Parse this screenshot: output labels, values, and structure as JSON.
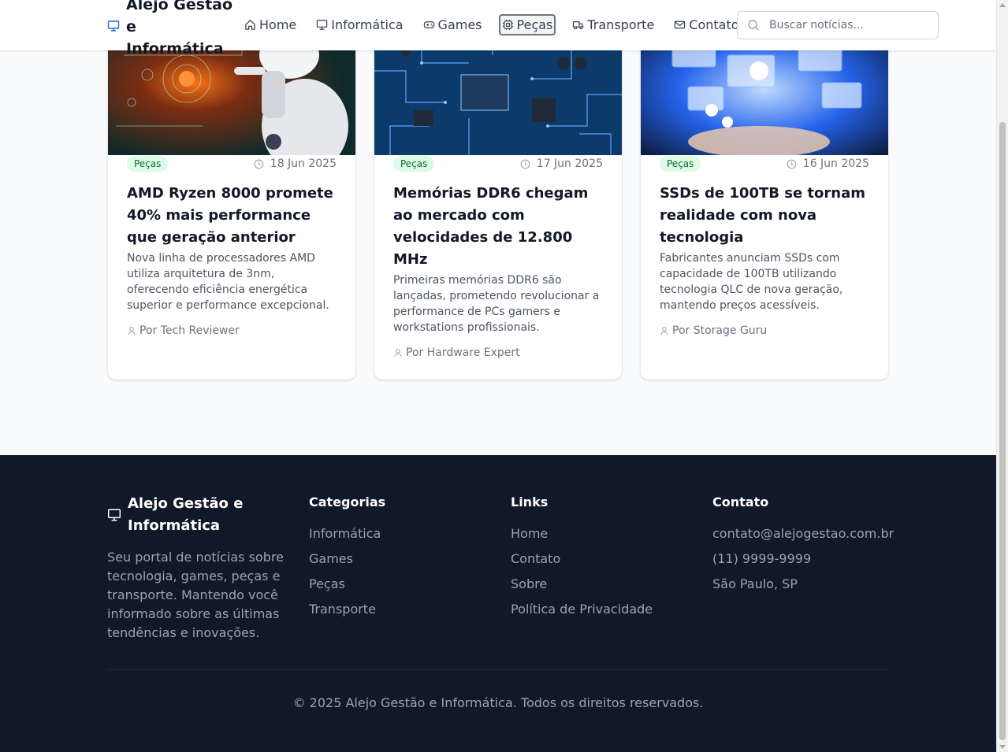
{
  "header": {
    "brand": "Alejo Gestão e Informática",
    "nav": [
      {
        "label": "Home",
        "icon": "home-icon"
      },
      {
        "label": "Informática",
        "icon": "monitor-icon"
      },
      {
        "label": "Games",
        "icon": "gamepad-icon"
      },
      {
        "label": "Peças",
        "icon": "cpu-icon",
        "active": true
      },
      {
        "label": "Transporte",
        "icon": "truck-icon"
      },
      {
        "label": "Contato",
        "icon": "mail-icon"
      }
    ],
    "search": {
      "placeholder": "Buscar notícias...",
      "value": ""
    }
  },
  "cards": [
    {
      "category": "Peças",
      "date": "18 Jun 2025",
      "title": "AMD Ryzen 8000 promete 40% mais performance que geração anterior",
      "description": "Nova linha de processadores AMD utiliza arquitetura de 3nm, oferecendo eficiência energética superior e performance excepcional.",
      "author": "Por Tech Reviewer"
    },
    {
      "category": "Peças",
      "date": "17 Jun 2025",
      "title": "Memórias DDR6 chegam ao mercado com velocidades de 12.800 MHz",
      "description": "Primeiras memórias DDR6 são lançadas, prometendo revolucionar a performance de PCs gamers e workstations profissionais.",
      "author": "Por Hardware Expert"
    },
    {
      "category": "Peças",
      "date": "16 Jun 2025",
      "title": "SSDs de 100TB se tornam realidade com nova tecnologia",
      "description": "Fabricantes anunciam SSDs com capacidade de 100TB utilizando tecnologia QLC de nova geração, mantendo preços acessíveis.",
      "author": "Por Storage Guru"
    }
  ],
  "footer": {
    "brand": "Alejo Gestão e Informática",
    "description": "Seu portal de notícias sobre tecnologia, games, peças e transporte. Mantendo você informado sobre as últimas tendências e inovações.",
    "categories": {
      "heading": "Categorias",
      "items": [
        "Informática",
        "Games",
        "Peças",
        "Transporte"
      ]
    },
    "links": {
      "heading": "Links",
      "items": [
        "Home",
        "Contato",
        "Sobre",
        "Política de Privacidade"
      ]
    },
    "contact": {
      "heading": "Contato",
      "items": [
        "contato@alejogestao.com.br",
        "(11) 9999-9999",
        "São Paulo, SP"
      ]
    },
    "copyright": "© 2025 Alejo Gestão e Informática. Todos os direitos reservados."
  },
  "colors": {
    "accent": "#2563eb",
    "badge_bg": "#dcfce7",
    "badge_text": "#166534",
    "footer_bg": "#111827"
  }
}
